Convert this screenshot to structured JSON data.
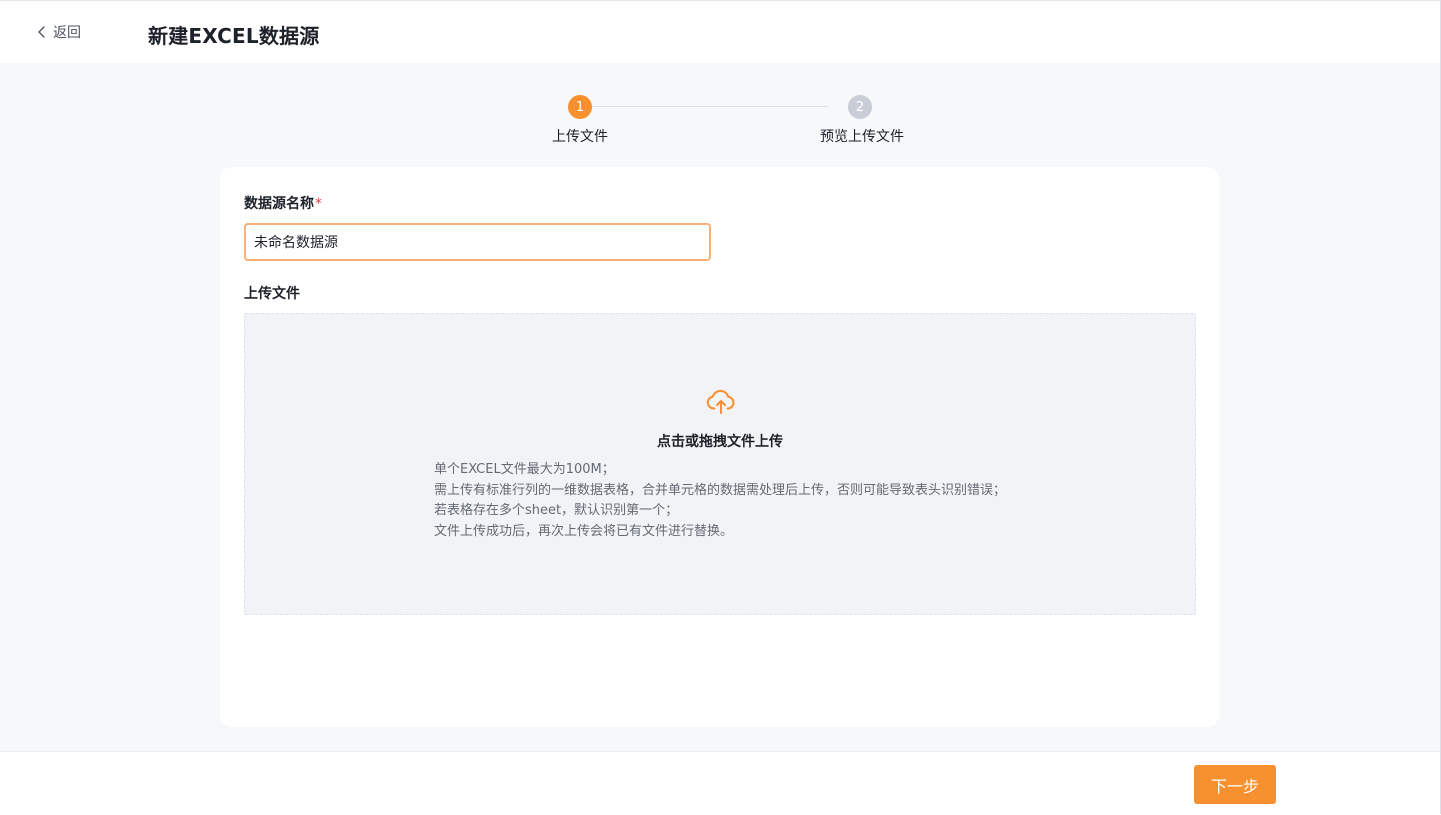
{
  "header": {
    "back_label": "返回",
    "title": "新建EXCEL数据源"
  },
  "steps": [
    {
      "number": "1",
      "label": "上传文件",
      "state": "active"
    },
    {
      "number": "2",
      "label": "预览上传文件",
      "state": "inactive"
    }
  ],
  "form": {
    "name_label": "数据源名称",
    "name_required_mark": "*",
    "name_value": "未命名数据源",
    "upload_label": "上传文件"
  },
  "dropzone": {
    "icon": "cloud-upload-icon",
    "title": "点击或拖拽文件上传",
    "hints": [
      "单个EXCEL文件最大为100M；",
      "需上传有标准行列的一维数据表格，合并单元格的数据需处理后上传，否则可能导致表头识别错误；",
      "若表格存在多个sheet，默认识别第一个；",
      "文件上传成功后，再次上传会将已有文件进行替换。"
    ]
  },
  "footer": {
    "next_label": "下一步"
  },
  "colors": {
    "accent": "#f7902e",
    "step_inactive": "#c9cdd6",
    "input_border": "#f7b07a",
    "required": "#f53f3f"
  }
}
